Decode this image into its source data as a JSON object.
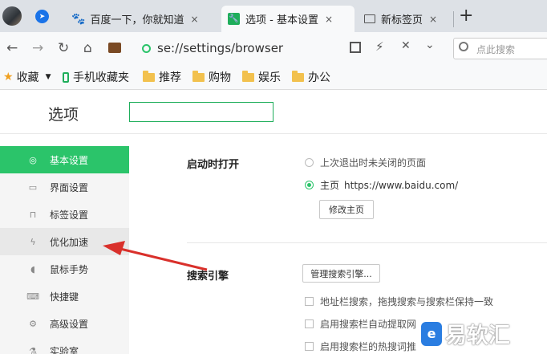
{
  "tabs": [
    {
      "label": "百度一下，你就知道",
      "close": "×"
    },
    {
      "label": "选项 - 基本设置",
      "close": "×"
    },
    {
      "label": "新标签页",
      "close": "×"
    }
  ],
  "new_tab": "+",
  "nav": {
    "back": "←",
    "forward": "→",
    "reload": "↻",
    "home": "⌂",
    "url": "se://settings/browser",
    "search_placeholder": "点此搜索",
    "icons": [
      "favicon-icon",
      "qr-code-icon",
      "lightning-icon",
      "chevron-down-icon",
      "search-icon"
    ]
  },
  "bookmarks": {
    "favorites": "收藏",
    "mobile": "手机收藏夹",
    "folders": [
      "推荐",
      "购物",
      "娱乐",
      "办公"
    ]
  },
  "settings": {
    "title": "选项",
    "sidebar": [
      {
        "label": "基本设置",
        "icon": "settings-icon"
      },
      {
        "label": "界面设置",
        "icon": "window-icon"
      },
      {
        "label": "标签设置",
        "icon": "tab-icon"
      },
      {
        "label": "优化加速",
        "icon": "lightning-icon"
      },
      {
        "label": "鼠标手势",
        "icon": "mouse-icon"
      },
      {
        "label": "快捷键",
        "icon": "keyboard-icon"
      },
      {
        "label": "高级设置",
        "icon": "wrench-icon"
      },
      {
        "label": "实验室",
        "icon": "flask-icon"
      }
    ],
    "startup": {
      "label": "启动时打开",
      "option_last": "上次退出时未关闭的页面",
      "option_home": "主页",
      "home_url": "https://www.baidu.com/",
      "change_home_button": "修改主页"
    },
    "search_engine": {
      "label": "搜索引擎",
      "manage_button": "管理搜索引擎...",
      "options": [
        "地址栏搜索，拖拽搜索与搜索栏保持一致",
        "启用搜索栏自动提取网",
        "启用搜索栏的热搜词推"
      ]
    }
  },
  "watermark": {
    "text": "易软汇"
  },
  "colors": {
    "accent": "#2bc46a",
    "annotation_arrow": "#d9302b"
  }
}
